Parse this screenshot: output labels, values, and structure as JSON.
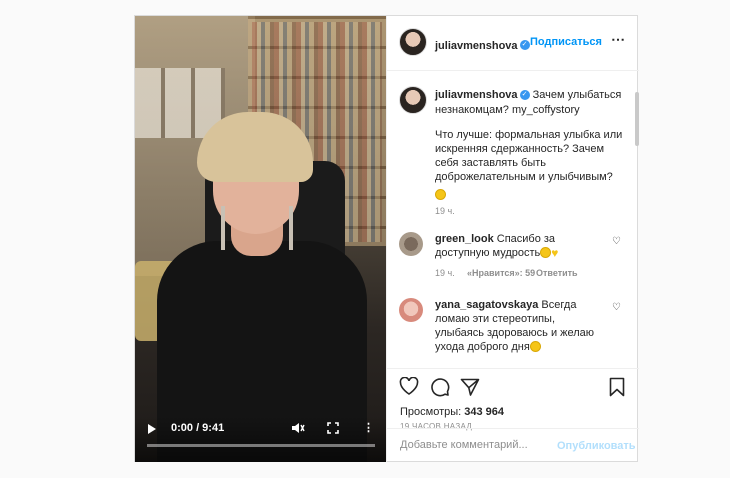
{
  "video": {
    "time": "0:00 / 9:41",
    "icons": {
      "play": "play-icon",
      "mute": "mute-icon",
      "fullscreen": "fullscreen-icon",
      "more": "more-icon"
    }
  },
  "header": {
    "username": "juliavmenshova",
    "dot": "•",
    "follow": "Подписаться",
    "options": "⋯"
  },
  "caption": {
    "username": "juliavmenshova",
    "line1": "Зачем улыбаться",
    "line2": "незнакомцам? my_coffystory",
    "body1": "Что лучше: формальная улыбка или",
    "body2": "искренняя сдержанность? Зачем",
    "body3": "себя заставлять быть",
    "body4": "доброжелательным и улыбчивым?",
    "time": "19 ч."
  },
  "comments": [
    {
      "username": "green_look",
      "text1": "Спасибо за",
      "text2": "доступную мудрость",
      "time": "19 ч.",
      "likes": "«Нравится»: 59",
      "reply": "Ответить"
    },
    {
      "username": "yana_sagatovskaya",
      "text1": "Всегда",
      "text2": "ломаю эти стереотипы,",
      "text3": "улыбаясь здороваюсь и желаю",
      "text4": "ухода доброго дня"
    }
  ],
  "stats": {
    "views_label": "Просмотры:",
    "views_value": "343 964",
    "posted": "19 ЧАСОВ НАЗАД"
  },
  "add_comment": {
    "placeholder": "Добавьте комментарий...",
    "publish": "Опубликовать"
  },
  "colors": {
    "accent": "#0095f6",
    "verified": "#3897f0",
    "border": "#dbdbdb",
    "muted": "#8e8e8e"
  }
}
